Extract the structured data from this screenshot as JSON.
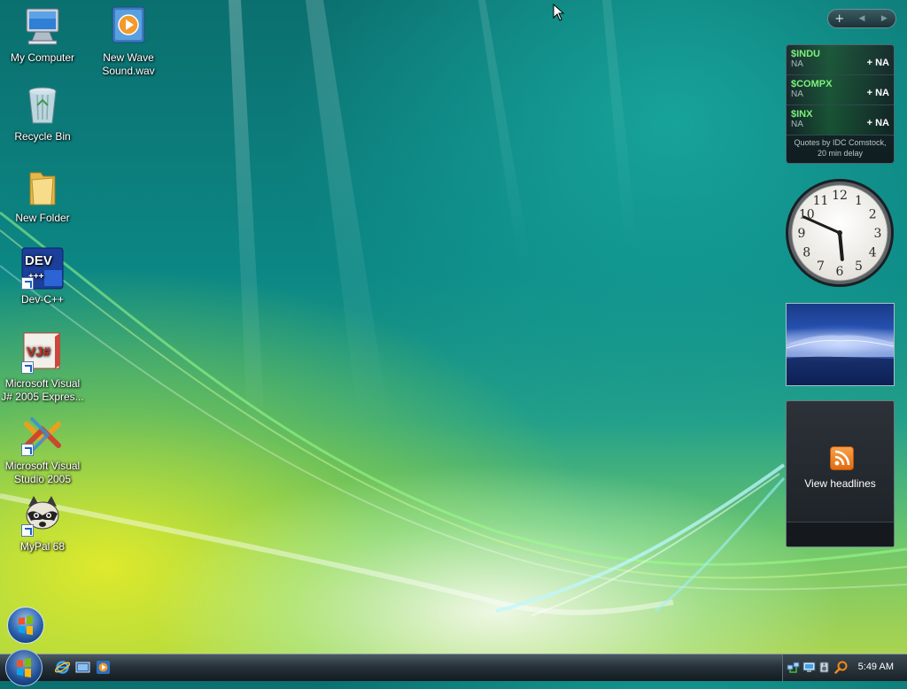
{
  "desktop": {
    "icons": [
      {
        "label": "My Computer",
        "icon": "computer-icon"
      },
      {
        "label": "New Wave Sound.wav",
        "icon": "media-file-icon"
      },
      {
        "label": "Recycle Bin",
        "icon": "recycle-bin-icon"
      },
      {
        "label": "New Folder",
        "icon": "folder-icon"
      },
      {
        "label": "Dev-C++",
        "icon": "devcpp-icon"
      },
      {
        "label": "Microsoft Visual J# 2005 Expres...",
        "icon": "visual-jsharp-icon"
      },
      {
        "label": "Microsoft Visual Studio 2005",
        "icon": "visual-studio-icon"
      },
      {
        "label": "MyPal 68",
        "icon": "mypal-icon"
      }
    ],
    "devcpp_badge": "DEV",
    "vj_badge": "VJ#"
  },
  "sidebar": {
    "add_label": "+",
    "prev_label": "◀",
    "next_label": "▶",
    "stocks": {
      "rows": [
        {
          "symbol": "$INDU",
          "value": "NA",
          "change": "+ NA"
        },
        {
          "symbol": "$COMPX",
          "value": "NA",
          "change": "+ NA"
        },
        {
          "symbol": "$INX",
          "value": "NA",
          "change": "+ NA"
        }
      ],
      "credit": "Quotes by IDC Comstock, 20 min delay"
    },
    "clock": {
      "numerals": [
        "12",
        "1",
        "2",
        "3",
        "4",
        "5",
        "6",
        "7",
        "8",
        "9",
        "10",
        "11"
      ],
      "hour": 5,
      "minute": 49
    },
    "feeds": {
      "label": "View headlines"
    }
  },
  "taskbar": {
    "quick_launch": [
      "internet-explorer-icon",
      "show-desktop-icon",
      "media-player-icon"
    ],
    "tray_icons": [
      "network-icon",
      "display-icon",
      "volume-icon",
      "search-tray-icon"
    ],
    "time": "5:49 AM"
  },
  "colors": {
    "stock_symbol": "#7df27a",
    "feed_orange": "#f28a2a",
    "wallpaper_teal": "#0c8784",
    "wallpaper_yellow": "#e4eb28"
  }
}
